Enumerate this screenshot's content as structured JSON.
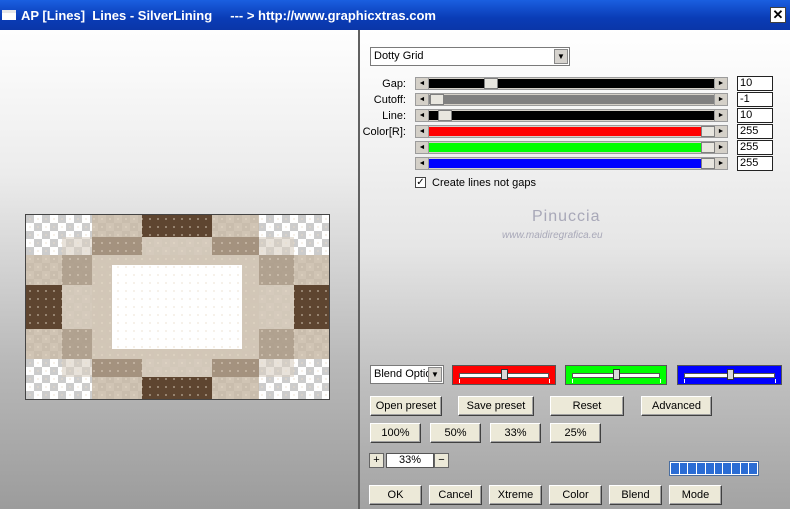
{
  "window": {
    "title": "AP [Lines]  Lines - SilverLining     --- > http://www.graphicxtras.com",
    "close_glyph": "✕"
  },
  "effect_select": {
    "value": "Dotty Grid"
  },
  "params": [
    {
      "label": "Gap:",
      "value": "10",
      "fraction": 0.2,
      "fill_color": "#000000"
    },
    {
      "label": "Cutoff:",
      "value": "-1",
      "fraction": 0.0,
      "fill_color": "#808080"
    },
    {
      "label": "Line:",
      "value": "10",
      "fraction": 0.03,
      "fill_color": "#000000"
    },
    {
      "label": "Color[R]:",
      "value": "255",
      "fraction": 1.0,
      "fill_color": "#ff0000"
    },
    {
      "label": "",
      "value": "255",
      "fraction": 1.0,
      "fill_color": "#00ff00"
    },
    {
      "label": "",
      "value": "255",
      "fraction": 1.0,
      "fill_color": "#0000ff"
    }
  ],
  "checkbox": {
    "label": "Create lines not gaps",
    "checked": true,
    "mark": "✓"
  },
  "watermark": {
    "name": "Pinuccia",
    "url": "www.maidiregrafica.eu"
  },
  "blend_select": {
    "value": "Blend Optio"
  },
  "channel_bars": [
    {
      "color": "#ff0000",
      "level": 0.5
    },
    {
      "color": "#00ff00",
      "level": 0.5
    },
    {
      "color": "#0000ff",
      "level": 0.5
    }
  ],
  "preset_buttons": {
    "open": "Open preset",
    "save": "Save preset",
    "reset": "Reset",
    "advanced": "Advanced"
  },
  "zoom_buttons": [
    "100%",
    "50%",
    "33%",
    "25%"
  ],
  "zoom": {
    "plus": "+",
    "value": "33%",
    "minus": "−"
  },
  "progress": {
    "segments": 10
  },
  "bottom_buttons": [
    "OK",
    "Cancel",
    "Xtreme",
    "Color",
    "Blend",
    "Mode"
  ]
}
